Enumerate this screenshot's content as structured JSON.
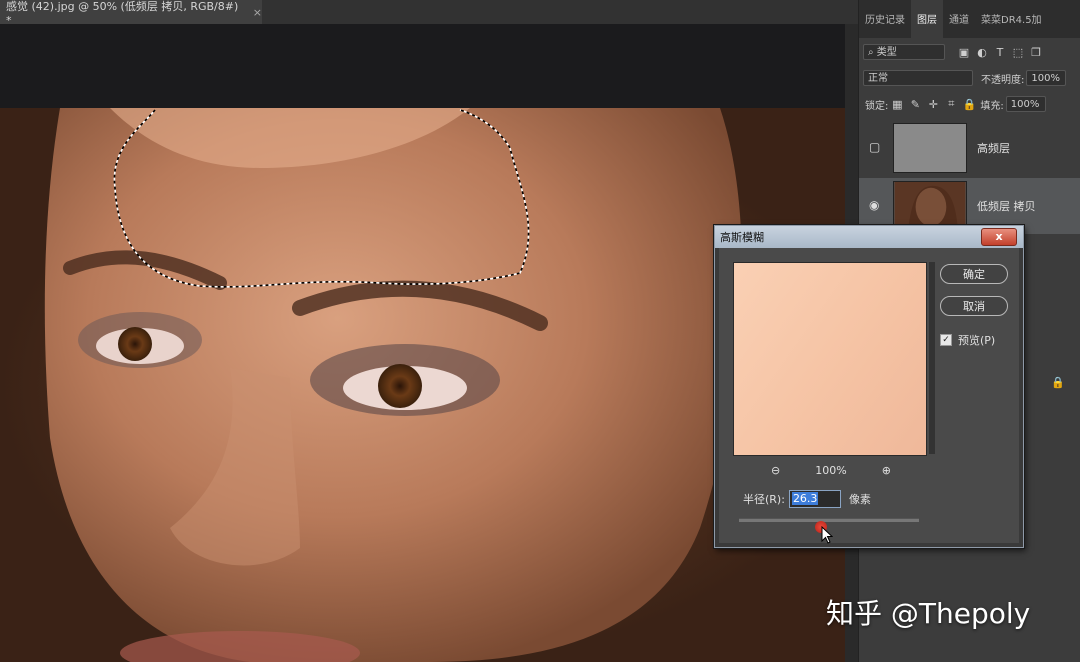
{
  "document": {
    "tab_title": "感觉 (42).jpg @ 50% (低频层 拷贝, RGB/8#) *",
    "close_glyph": "×"
  },
  "panel": {
    "tabs": [
      "历史记录",
      "图层",
      "通道",
      "菜菜DR4.5加"
    ],
    "active_tab": "图层",
    "filter": {
      "icon": "search-icon",
      "label": "类型"
    },
    "blend_mode": "正常",
    "opacity_label": "不透明度:",
    "opacity_value": "100%",
    "lock_label": "锁定:",
    "fill_label": "填充:",
    "fill_value": "100%",
    "layers": [
      {
        "name": "高频层",
        "visible": false,
        "selected": false
      },
      {
        "name": "低频层 拷贝",
        "visible": true,
        "selected": true
      }
    ]
  },
  "dialog": {
    "title": "高斯模糊",
    "close_glyph": "x",
    "ok_label": "确定",
    "cancel_label": "取消",
    "preview_label": "预览(P)",
    "preview_checked": true,
    "zoom_level": "100%",
    "radius_label": "半径(R):",
    "radius_value": "26.3",
    "radius_unit": "像素"
  },
  "watermark": "知乎 @Thepoly"
}
